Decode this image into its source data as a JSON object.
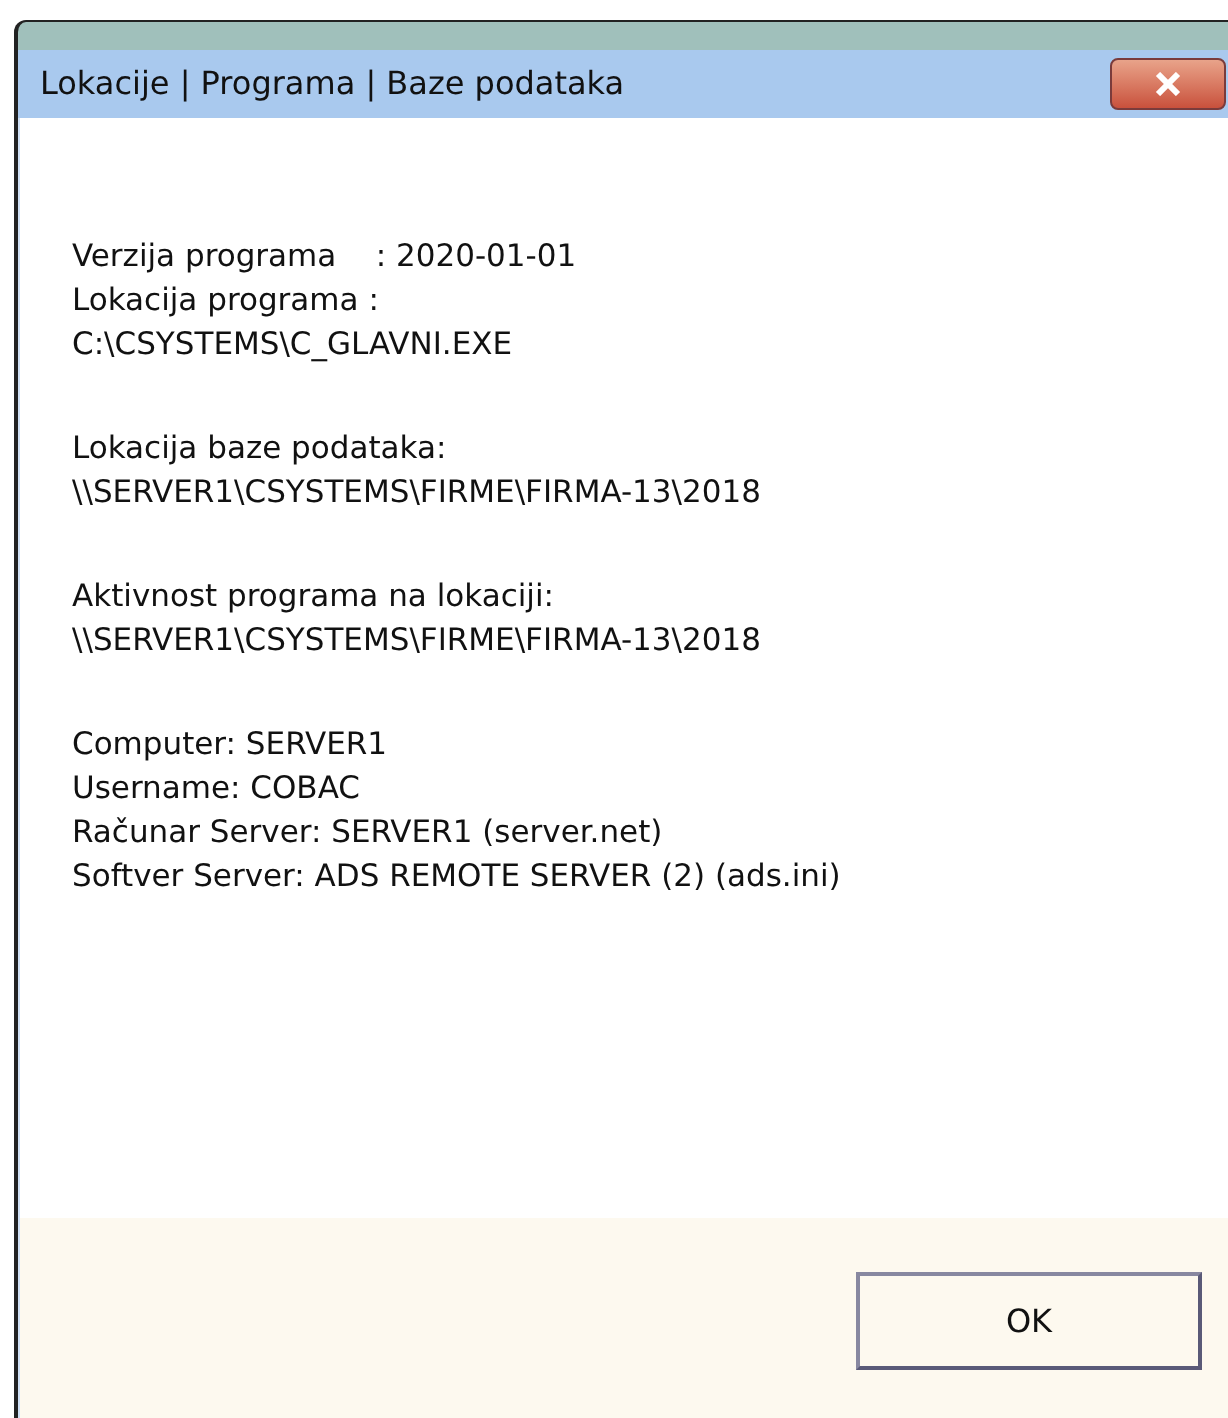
{
  "window": {
    "title": "Lokacije | Programa | Baze podataka"
  },
  "groups": [
    [
      "Verzija programa    : 2020-01-01",
      "Lokacija programa :",
      "C:\\CSYSTEMS\\C_GLAVNI.EXE"
    ],
    [
      "Lokacija baze podataka:",
      "\\\\SERVER1\\CSYSTEMS\\FIRME\\FIRMA-13\\2018"
    ],
    [
      "Aktivnost programa na lokaciji:",
      "\\\\SERVER1\\CSYSTEMS\\FIRME\\FIRMA-13\\2018"
    ],
    [
      "Computer: SERVER1",
      "Username: COBAC",
      "Računar Server: SERVER1 (server.net)",
      "Softver Server: ADS REMOTE SERVER (2) (ads.ini)"
    ]
  ],
  "buttons": [
    "OK"
  ]
}
